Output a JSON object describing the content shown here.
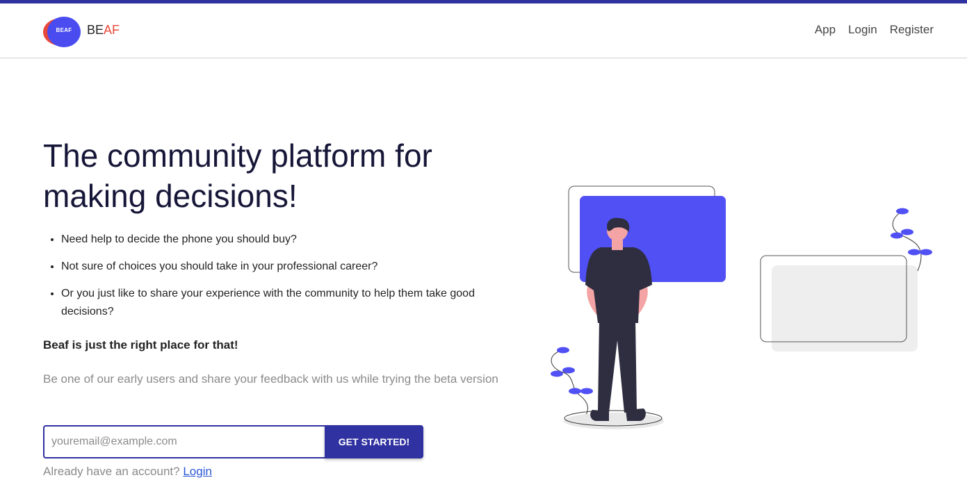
{
  "brand": {
    "logo_text": "BEAF",
    "name_part1": "BE",
    "name_part2": "AF"
  },
  "nav": {
    "items": [
      {
        "label": "App"
      },
      {
        "label": "Login"
      },
      {
        "label": "Register"
      }
    ]
  },
  "hero": {
    "title": "The community platform for making decisions!",
    "bullets": [
      "Need help to decide the phone you should buy?",
      "Not sure of choices you should take in your professional career?",
      "Or you just like to share your experience with the community to help them take good decisions?"
    ],
    "tagline": "Beaf is just the right place for that!",
    "subtext": "Be one of our early users and share your feedback with us while trying the beta version"
  },
  "signup": {
    "email_placeholder": "youremail@example.com",
    "email_value": "",
    "button_label": "GET STARTED!",
    "already_text": "Already have an account?",
    "login_link": "Login"
  },
  "colors": {
    "primary": "#2f32a0",
    "accent": "#e8483a",
    "illustration_blue": "#5050f5"
  },
  "icons": {
    "logo": "beaf-logo",
    "illustration": "person-looking-at-screens-illustration"
  }
}
